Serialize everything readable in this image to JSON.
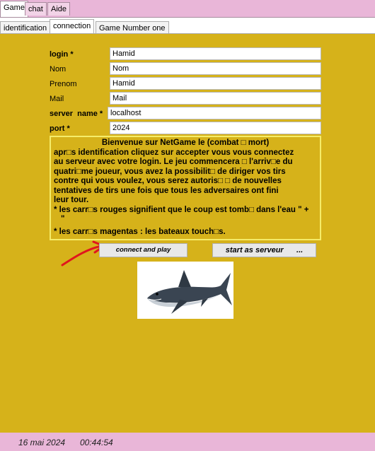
{
  "top_tabs": [
    "Game",
    "chat",
    "Aide"
  ],
  "sub_tabs": [
    "identification",
    "connection",
    "Game Number one"
  ],
  "form": {
    "login_label": "login *",
    "login_value": "Hamid",
    "nom_label": "Nom",
    "nom_value": "Nom",
    "prenom_label": "Prenom",
    "prenom_value": "Hamid",
    "mail_label": "Mail",
    "mail_value": "Mail",
    "server_label": "server  name *",
    "server_value": "localhost",
    "port_label": "port *",
    "port_value": "2024"
  },
  "info": {
    "title": "Bienvenue sur NetGame le (combat □ mort)",
    "line1": "apr□s identification cliquez sur accepter vous vous connectez",
    "line2": "au serveur avec votre login. Le jeu commencera □ l'arriv□e du",
    "line3": "quatri□me joueur, vous avez la possibilit□ de diriger vos tirs",
    "line4": "contre qui vous voulez, vous serez autoris□ □ de nouvelles",
    "line5": "tentatives de tirs une fois que tous les adversaires ont fini",
    "line6": "leur tour.",
    "line7": "* les carr□s rouges signifient que le coup est tomb□ dans l'eau \" +",
    "line8": "\"",
    "line9": "* les carr□s magentas : les bateaux touch□s."
  },
  "buttons": {
    "connect": "connect and play",
    "serveur": "start as serveur      ..."
  },
  "status": {
    "date": "16 mai 2024",
    "time": "00:44:54"
  },
  "colors": {
    "panel": "#d6b21a",
    "chrome": "#e9b6d8",
    "info_border": "#f5ec6a",
    "arrow": "#e0161d"
  },
  "icons": [
    "shark-image",
    "red-arrow-annotation"
  ]
}
